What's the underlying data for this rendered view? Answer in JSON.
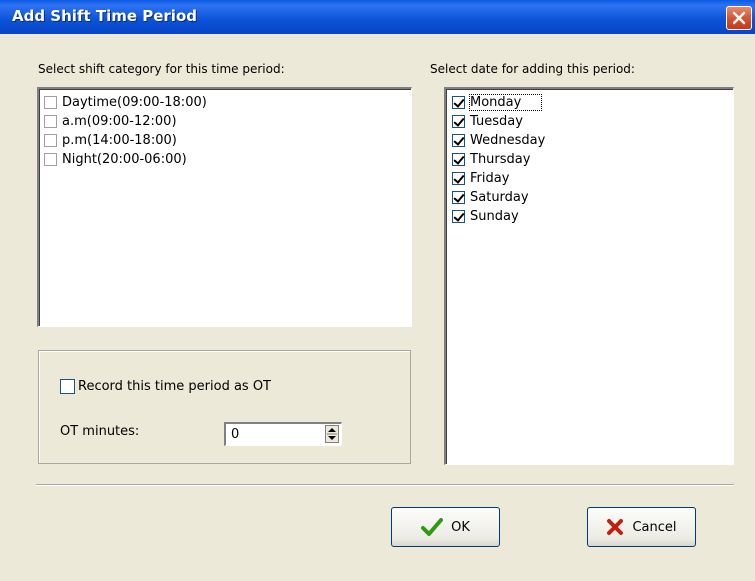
{
  "window": {
    "title": "Add Shift Time Period"
  },
  "shift_category": {
    "label": "Select shift category for this time period:",
    "items": [
      {
        "label": "Daytime(09:00-18:00)",
        "checked": false
      },
      {
        "label": "a.m(09:00-12:00)",
        "checked": false
      },
      {
        "label": "p.m(14:00-18:00)",
        "checked": false
      },
      {
        "label": "Night(20:00-06:00)",
        "checked": false
      }
    ]
  },
  "dates": {
    "label": "Select date for adding this period:",
    "items": [
      {
        "label": "Monday",
        "checked": true
      },
      {
        "label": "Tuesday",
        "checked": true
      },
      {
        "label": "Wednesday",
        "checked": true
      },
      {
        "label": "Thursday",
        "checked": true
      },
      {
        "label": "Friday",
        "checked": true
      },
      {
        "label": "Saturday",
        "checked": true
      },
      {
        "label": "Sunday",
        "checked": true
      }
    ]
  },
  "ot": {
    "record_label": "Record this time period as OT",
    "record_checked": false,
    "minutes_label": "OT minutes:",
    "minutes_value": "0"
  },
  "buttons": {
    "ok_label": "OK",
    "cancel_label": "Cancel"
  },
  "icons": {
    "close": "close-icon",
    "ok": "checkmark-icon",
    "cancel": "x-icon"
  },
  "colors": {
    "titlebar": "#0a52d8",
    "window_bg": "#ece9d8",
    "ok_icon": "#2e9a14",
    "cancel_icon": "#c41e0e"
  }
}
